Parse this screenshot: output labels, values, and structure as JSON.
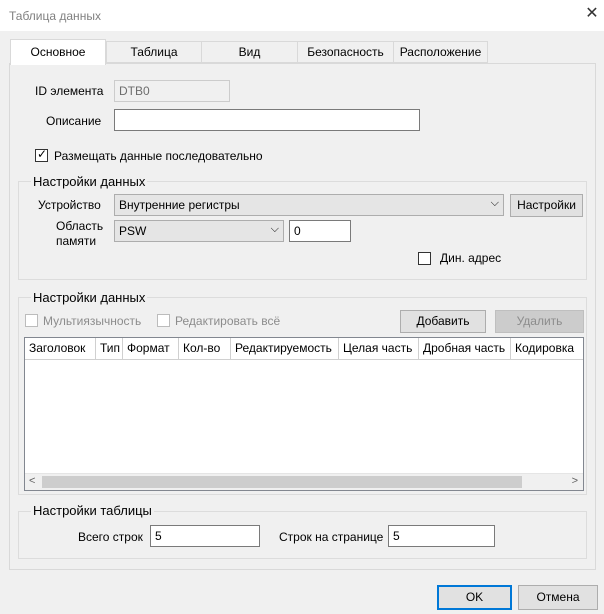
{
  "window": {
    "title": "Таблица данных",
    "close": "✕"
  },
  "tabs": [
    {
      "label": "Основное"
    },
    {
      "label": "Таблица"
    },
    {
      "label": "Вид"
    },
    {
      "label": "Безопасность"
    },
    {
      "label": "Расположение"
    }
  ],
  "general": {
    "id_label": "ID элемента",
    "id_value": "DTB0",
    "desc_label": "Описание",
    "desc_value": "",
    "sequential_label": "Размещать данные последовательно",
    "sequential_checked": true
  },
  "data_settings": {
    "title": "Настройки данных",
    "device_label": "Устройство",
    "device_value": "Внутренние регистры",
    "settings_btn": "Настройки",
    "mem_label_1": "Область",
    "mem_label_2": "памяти",
    "mem_value": "PSW",
    "addr_value": "0",
    "dyn_label": "Дин. адрес"
  },
  "data_columns": {
    "title": "Настройки данных",
    "multilang_label": "Мультиязычность",
    "edit_all_label": "Редактировать всё",
    "add_btn": "Добавить",
    "delete_btn": "Удалить",
    "headers": [
      "Заголовок",
      "Тип",
      "Формат",
      "Кол-во",
      "Редактируемость",
      "Целая часть",
      "Дробная часть",
      "Кодировка"
    ],
    "scroll_left": "<",
    "scroll_right": ">"
  },
  "table_settings": {
    "title": "Настройки таблицы",
    "total_rows_label": "Всего строк",
    "total_rows_value": "5",
    "rows_per_page_label": "Строк на странице",
    "rows_per_page_value": "5"
  },
  "footer": {
    "ok": "OK",
    "cancel": "Отмена"
  }
}
